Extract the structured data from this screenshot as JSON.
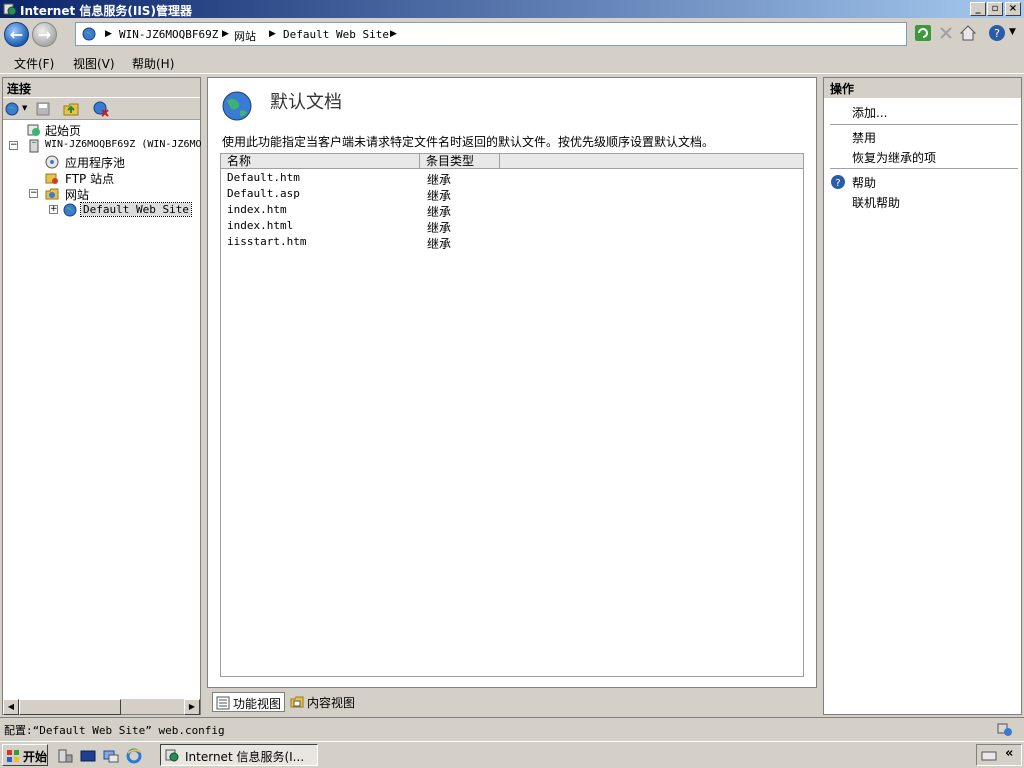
{
  "window": {
    "title": "Internet 信息服务(IIS)管理器"
  },
  "address": {
    "crumbs": [
      "WIN-JZ6MOQBF69Z",
      "网站",
      "Default Web Site"
    ]
  },
  "menu": {
    "file": "文件(F)",
    "view": "视图(V)",
    "help": "帮助(H)"
  },
  "connections": {
    "header": "连接",
    "tree": {
      "start_page": "起始页",
      "server": "WIN-JZ6MOQBF69Z (WIN-JZ6MO",
      "app_pools": "应用程序池",
      "ftp_sites": "FTP 站点",
      "sites": "网站",
      "default_site": "Default Web Site"
    }
  },
  "feature": {
    "title": "默认文档",
    "description": "使用此功能指定当客户端未请求特定文件名时返回的默认文件。按优先级顺序设置默认文档。",
    "columns": [
      "名称",
      "条目类型"
    ],
    "rows": [
      {
        "name": "Default.htm",
        "type": "继承"
      },
      {
        "name": "Default.asp",
        "type": "继承"
      },
      {
        "name": "index.htm",
        "type": "继承"
      },
      {
        "name": "index.html",
        "type": "继承"
      },
      {
        "name": "iisstart.htm",
        "type": "继承"
      }
    ]
  },
  "view_tabs": {
    "features": "功能视图",
    "content": "内容视图"
  },
  "actions": {
    "header": "操作",
    "add": "添加...",
    "disable": "禁用",
    "revert": "恢复为继承的项",
    "help": "帮助",
    "online_help": "联机帮助"
  },
  "status": {
    "text": "配置:“Default Web Site” web.config"
  },
  "taskbar": {
    "start": "开始",
    "task_iis": "Internet 信息服务(I..."
  },
  "colors": {
    "title_start": "#0a246a",
    "title_end": "#a6caf0",
    "chrome": "#d4d0c8"
  },
  "icons": [
    "globe-icon",
    "back-icon",
    "forward-icon",
    "refresh-icon",
    "stop-icon",
    "home-icon",
    "help-icon",
    "server-icon",
    "app-pool-icon",
    "ftp-icon",
    "sites-folder-icon"
  ]
}
